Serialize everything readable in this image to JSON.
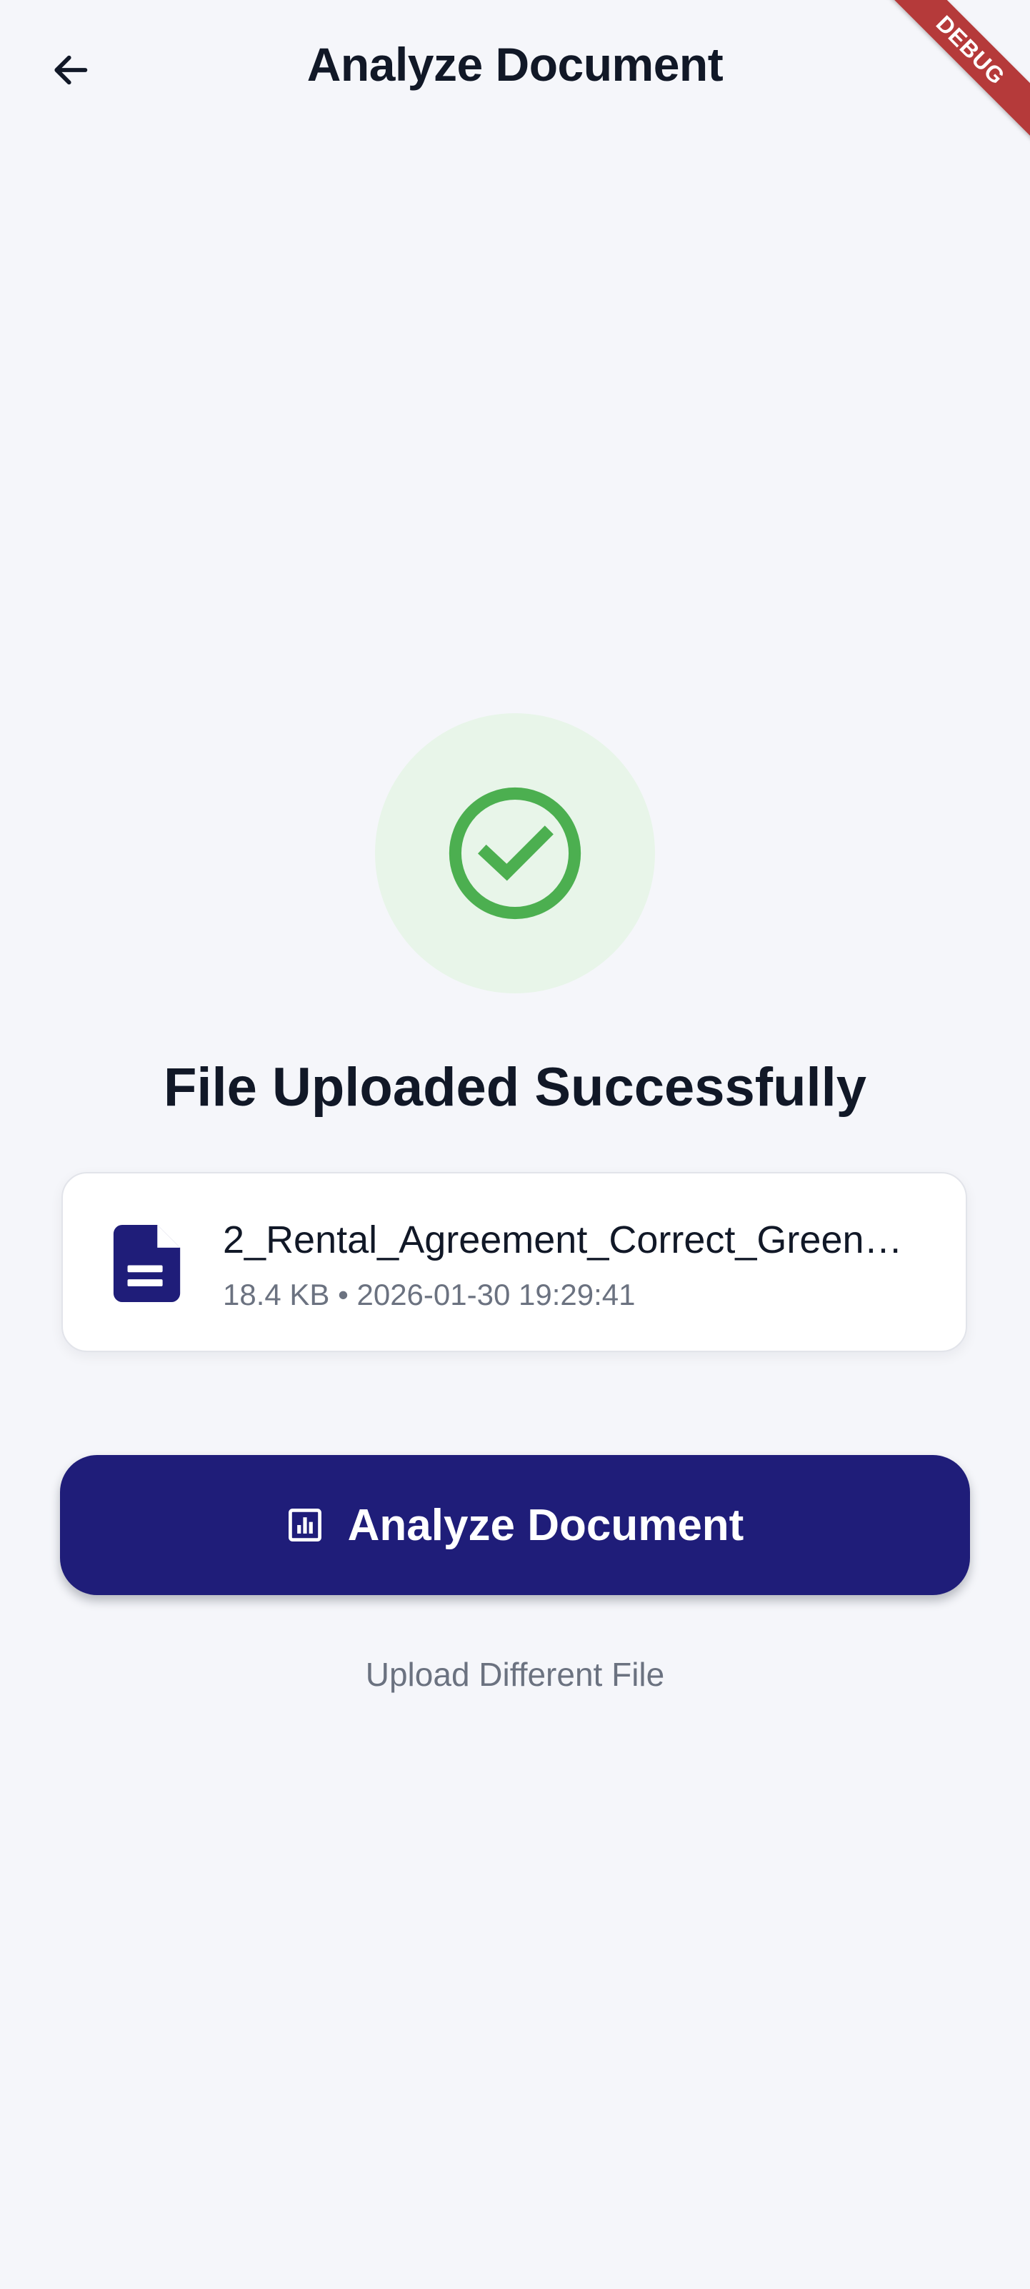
{
  "app_bar": {
    "title": "Analyze Document",
    "back_icon": "arrow-left-icon"
  },
  "debug_banner": {
    "label": "DEBUG"
  },
  "status": {
    "icon": "check-circle-icon",
    "title": "File Uploaded Successfully",
    "accent_color": "#4caf50",
    "circle_color": "#e8f5e9"
  },
  "file": {
    "icon": "document-icon",
    "name": "2_Rental_Agreement_Correct_Green…",
    "meta": "18.4 KB • 2026-01-30 19:29:41"
  },
  "actions": {
    "analyze_label": "Analyze Document",
    "analyze_icon": "analytics-icon",
    "upload_different_label": "Upload Different File"
  },
  "colors": {
    "primary": "#1f1d79",
    "background": "#f5f6fa",
    "text_primary": "#111827",
    "text_secondary": "#6b7280"
  }
}
